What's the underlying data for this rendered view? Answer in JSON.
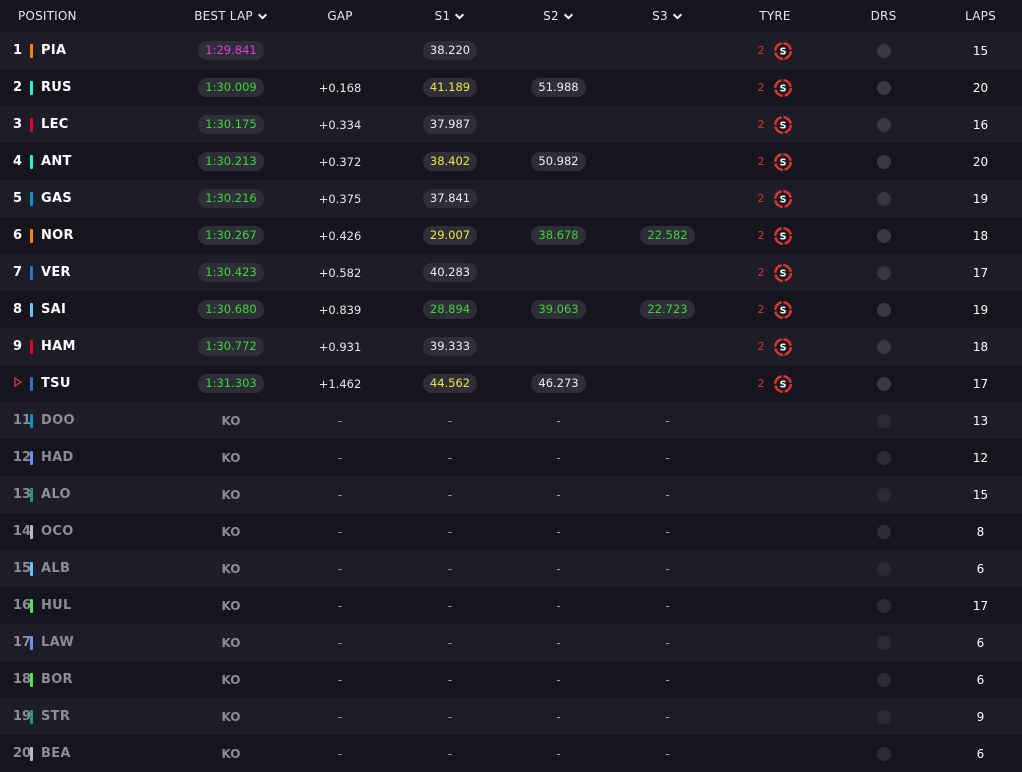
{
  "headers": {
    "position": "POSITION",
    "best_lap": "BEST LAP",
    "gap": "GAP",
    "s1": "S1",
    "s2": "S2",
    "s3": "S3",
    "tyre": "TYRE",
    "drs": "DRS",
    "laps": "LAPS"
  },
  "colors": {
    "purple": "#e23cd6",
    "green": "#3bd634",
    "yellow": "#f2e63a",
    "tyre_soft": "#e0342f"
  },
  "rows": [
    {
      "pos": "1",
      "code": "PIA",
      "team_color": "#ff8000",
      "best": "1:29.841",
      "best_style": "purple",
      "gap": "",
      "s1": "38.220",
      "s1_style": "white",
      "s2": "",
      "s2_style": "",
      "s3": "",
      "s3_style": "",
      "tyre_age": "2",
      "tyre": "S",
      "laps": "15",
      "out": false
    },
    {
      "pos": "2",
      "code": "RUS",
      "team_color": "#27f4d2",
      "best": "1:30.009",
      "best_style": "green",
      "gap": "+0.168",
      "s1": "41.189",
      "s1_style": "yellow",
      "s2": "51.988",
      "s2_style": "white",
      "s3": "",
      "s3_style": "",
      "tyre_age": "2",
      "tyre": "S",
      "laps": "20",
      "out": false
    },
    {
      "pos": "3",
      "code": "LEC",
      "team_color": "#e8002d",
      "best": "1:30.175",
      "best_style": "green",
      "gap": "+0.334",
      "s1": "37.987",
      "s1_style": "white",
      "s2": "",
      "s2_style": "",
      "s3": "",
      "s3_style": "",
      "tyre_age": "2",
      "tyre": "S",
      "laps": "16",
      "out": false
    },
    {
      "pos": "4",
      "code": "ANT",
      "team_color": "#27f4d2",
      "best": "1:30.213",
      "best_style": "green",
      "gap": "+0.372",
      "s1": "38.402",
      "s1_style": "yellow",
      "s2": "50.982",
      "s2_style": "white",
      "s3": "",
      "s3_style": "",
      "tyre_age": "2",
      "tyre": "S",
      "laps": "20",
      "out": false
    },
    {
      "pos": "5",
      "code": "GAS",
      "team_color": "#0093cc",
      "best": "1:30.216",
      "best_style": "green",
      "gap": "+0.375",
      "s1": "37.841",
      "s1_style": "white",
      "s2": "",
      "s2_style": "",
      "s3": "",
      "s3_style": "",
      "tyre_age": "2",
      "tyre": "S",
      "laps": "19",
      "out": false
    },
    {
      "pos": "6",
      "code": "NOR",
      "team_color": "#ff8000",
      "best": "1:30.267",
      "best_style": "green",
      "gap": "+0.426",
      "s1": "29.007",
      "s1_style": "yellow",
      "s2": "38.678",
      "s2_style": "green",
      "s3": "22.582",
      "s3_style": "green",
      "tyre_age": "2",
      "tyre": "S",
      "laps": "18",
      "out": false
    },
    {
      "pos": "7",
      "code": "VER",
      "team_color": "#3671c6",
      "best": "1:30.423",
      "best_style": "green",
      "gap": "+0.582",
      "s1": "40.283",
      "s1_style": "white",
      "s2": "",
      "s2_style": "",
      "s3": "",
      "s3_style": "",
      "tyre_age": "2",
      "tyre": "S",
      "laps": "17",
      "out": false
    },
    {
      "pos": "8",
      "code": "SAI",
      "team_color": "#64c4ff",
      "best": "1:30.680",
      "best_style": "green",
      "gap": "+0.839",
      "s1": "28.894",
      "s1_style": "green",
      "s2": "39.063",
      "s2_style": "green",
      "s3": "22.723",
      "s3_style": "green",
      "tyre_age": "2",
      "tyre": "S",
      "laps": "19",
      "out": false
    },
    {
      "pos": "9",
      "code": "HAM",
      "team_color": "#e8002d",
      "best": "1:30.772",
      "best_style": "green",
      "gap": "+0.931",
      "s1": "39.333",
      "s1_style": "white",
      "s2": "",
      "s2_style": "",
      "s3": "",
      "s3_style": "",
      "tyre_age": "2",
      "tyre": "S",
      "laps": "18",
      "out": false
    },
    {
      "pos": "",
      "code": "TSU",
      "team_color": "#3671c6",
      "best": "1:31.303",
      "best_style": "green",
      "gap": "+1.462",
      "s1": "44.562",
      "s1_style": "yellow",
      "s2": "46.273",
      "s2_style": "white",
      "s3": "",
      "s3_style": "",
      "tyre_age": "2",
      "tyre": "S",
      "laps": "17",
      "out": false,
      "flag": true
    },
    {
      "pos": "11",
      "code": "DOO",
      "team_color": "#0093cc",
      "best": "KO",
      "gap": "-",
      "s1": "-",
      "s2": "-",
      "s3": "-",
      "laps": "13",
      "out": true
    },
    {
      "pos": "12",
      "code": "HAD",
      "team_color": "#6692ff",
      "best": "KO",
      "gap": "-",
      "s1": "-",
      "s2": "-",
      "s3": "-",
      "laps": "12",
      "out": true
    },
    {
      "pos": "13",
      "code": "ALO",
      "team_color": "#229971",
      "best": "KO",
      "gap": "-",
      "s1": "-",
      "s2": "-",
      "s3": "-",
      "laps": "15",
      "out": true
    },
    {
      "pos": "14",
      "code": "OCO",
      "team_color": "#b6babd",
      "best": "KO",
      "gap": "-",
      "s1": "-",
      "s2": "-",
      "s3": "-",
      "laps": "8",
      "out": true
    },
    {
      "pos": "15",
      "code": "ALB",
      "team_color": "#64c4ff",
      "best": "KO",
      "gap": "-",
      "s1": "-",
      "s2": "-",
      "s3": "-",
      "laps": "6",
      "out": true
    },
    {
      "pos": "16",
      "code": "HUL",
      "team_color": "#52e252",
      "best": "KO",
      "gap": "-",
      "s1": "-",
      "s2": "-",
      "s3": "-",
      "laps": "17",
      "out": true
    },
    {
      "pos": "17",
      "code": "LAW",
      "team_color": "#6692ff",
      "best": "KO",
      "gap": "-",
      "s1": "-",
      "s2": "-",
      "s3": "-",
      "laps": "6",
      "out": true
    },
    {
      "pos": "18",
      "code": "BOR",
      "team_color": "#52e252",
      "best": "KO",
      "gap": "-",
      "s1": "-",
      "s2": "-",
      "s3": "-",
      "laps": "6",
      "out": true
    },
    {
      "pos": "19",
      "code": "STR",
      "team_color": "#229971",
      "best": "KO",
      "gap": "-",
      "s1": "-",
      "s2": "-",
      "s3": "-",
      "laps": "9",
      "out": true
    },
    {
      "pos": "20",
      "code": "BEA",
      "team_color": "#b6babd",
      "best": "KO",
      "gap": "-",
      "s1": "-",
      "s2": "-",
      "s3": "-",
      "laps": "6",
      "out": true
    }
  ]
}
